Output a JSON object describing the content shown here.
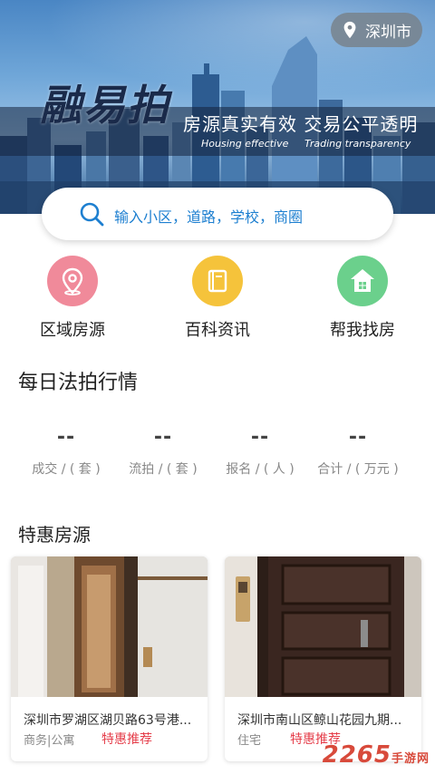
{
  "banner": {
    "logo": "融易拍",
    "slogan": "房源真实有效 交易公平透明",
    "slogan_en_left": "Housing effective",
    "slogan_en_right": "Trading transparency",
    "city": "深圳市"
  },
  "search": {
    "placeholder": "输入小区，道路，学校，商圈"
  },
  "categories": [
    {
      "label": "区域房源",
      "icon": "location-pin-icon",
      "color": "#f08a9a"
    },
    {
      "label": "百科资讯",
      "icon": "book-icon",
      "color": "#f5c33b"
    },
    {
      "label": "帮我找房",
      "icon": "house-icon",
      "color": "#6bd08c"
    }
  ],
  "daily": {
    "title": "每日法拍行情",
    "stats": [
      {
        "value": "--",
        "label": "成交 / ( 套 )"
      },
      {
        "value": "--",
        "label": "流拍 / ( 套 )"
      },
      {
        "value": "--",
        "label": "报名 / ( 人 )"
      },
      {
        "value": "--",
        "label": "合计 / ( 万元 )"
      }
    ]
  },
  "special": {
    "title": "特惠房源",
    "cards": [
      {
        "title": "深圳市罗湖区湖贝路63号港...",
        "type": "商务|公寓",
        "tag": "特惠推荐"
      },
      {
        "title": "深圳市南山区鲸山花园九期...",
        "type": "住宅",
        "tag": "特惠推荐"
      }
    ]
  },
  "watermark": {
    "brand": "2265",
    "suffix": "手游网"
  }
}
